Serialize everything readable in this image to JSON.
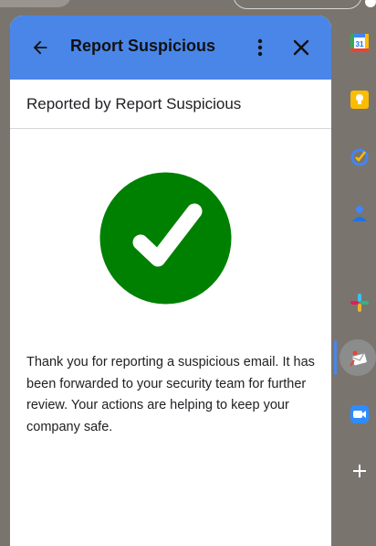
{
  "header": {
    "title": "Report Suspicious",
    "back_icon": "arrow-left-icon",
    "menu_icon": "more-vert-icon",
    "close_icon": "close-icon",
    "bg_color": "#4a86e8"
  },
  "subheader": {
    "text": "Reported by Report Suspicious"
  },
  "status": {
    "icon": "checkmark-circle-icon",
    "color": "#008000"
  },
  "message": {
    "text": "Thank you for reporting a suspicious email. It has been forwarded to your security team for further review. Your actions are helping to keep your company safe."
  },
  "rail": {
    "items": [
      {
        "name": "calendar-icon",
        "label": "31"
      },
      {
        "name": "keep-icon"
      },
      {
        "name": "tasks-icon"
      },
      {
        "name": "contacts-icon"
      },
      {
        "name": "slack-icon"
      },
      {
        "name": "report-suspicious-icon"
      },
      {
        "name": "zoom-icon"
      },
      {
        "name": "add-icon"
      }
    ]
  }
}
